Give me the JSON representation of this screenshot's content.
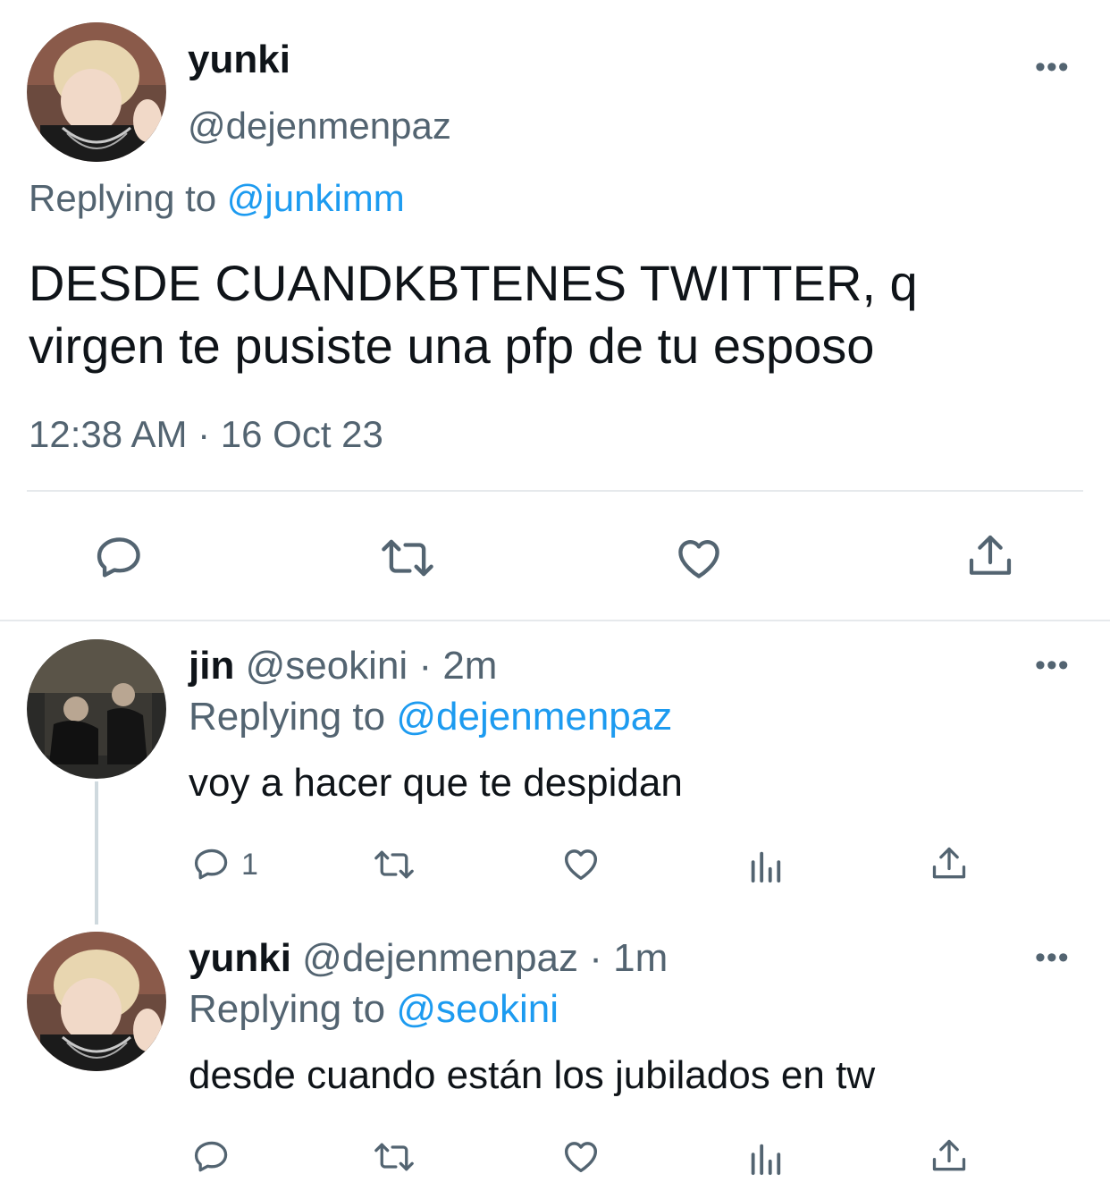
{
  "main_tweet": {
    "display_name": "yunki",
    "handle": "@dejenmenpaz",
    "replying_prefix": "Replying to",
    "replying_to": "@junkimm",
    "text": "DESDE CUANDKBTENES TWITTER, q virgen te pusiste una pfp de tu esposo",
    "timestamp": "12:38 AM · 16 Oct 23",
    "more": "•••"
  },
  "replies": [
    {
      "display_name": "jin",
      "handle": "@seokini",
      "separator": "·",
      "time": "2m",
      "replying_prefix": "Replying to",
      "replying_to": "@dejenmenpaz",
      "text": "voy a hacer que te despidan",
      "reply_count": "1",
      "more": "•••"
    },
    {
      "display_name": "yunki",
      "handle": "@dejenmenpaz",
      "separator": "·",
      "time": "1m",
      "replying_prefix": "Replying to",
      "replying_to": "@seokini",
      "text": "desde cuando están los jubilados en tw",
      "more": "•••"
    }
  ],
  "icons": {
    "reply": "speech-bubble-icon",
    "retweet": "retweet-arrows-icon",
    "like": "heart-icon",
    "share": "share-upload-icon",
    "views": "bar-chart-icon",
    "more": "ellipsis-icon"
  },
  "colors": {
    "text": "#0f1419",
    "muted": "#536471",
    "link": "#1d9bf0",
    "divider": "#e6e9ec"
  }
}
